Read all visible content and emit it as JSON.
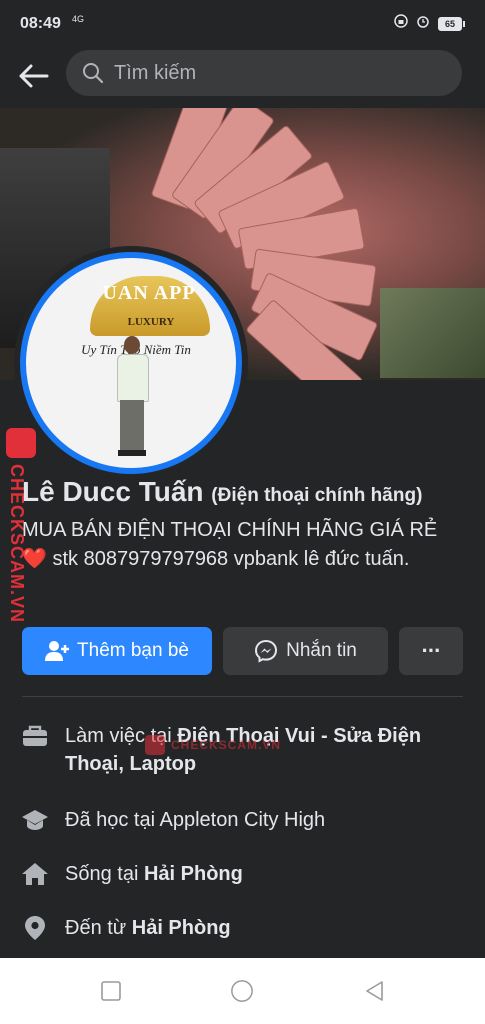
{
  "status_bar": {
    "time": "08:49",
    "network": "4G",
    "battery": "65"
  },
  "search": {
    "placeholder": "Tìm kiếm"
  },
  "avatar": {
    "logo_text": "UAN APP",
    "luxury_text": "LUXURY",
    "slogan": "Uy Tín Tạo Niềm Tin"
  },
  "watermark": {
    "text": "CHECKSCAM.VN"
  },
  "profile": {
    "name": "Lê Ducc Tuấn",
    "name_suffix": "(Điện thoại chính hãng)",
    "bio_part1": "MUA BÁN ĐIỆN THOẠI CHÍNH HÃNG GIÁ RẺ",
    "bio_heart": "❤️",
    "bio_part2": "stk 8087979797968 vpbank lê đức tuấn."
  },
  "actions": {
    "add_friend": "Thêm bạn bè",
    "message": "Nhắn tin",
    "more": "···"
  },
  "info": {
    "work_prefix": "Làm việc tại ",
    "work_place": "Điện Thoại Vui - Sửa Điện Thoại, Laptop",
    "study": "Đã học tại Appleton City High",
    "live_prefix": "Sống tại ",
    "live_place": "Hải Phòng",
    "from_prefix": "Đến từ ",
    "from_place": "Hải Phòng"
  },
  "colors": {
    "background": "#242526",
    "primary_button": "#2d88ff",
    "secondary_button": "#3a3b3c",
    "watermark_red": "#e2303a"
  },
  "icons": [
    "back-arrow-icon",
    "search-icon",
    "add-friend-icon",
    "messenger-icon",
    "more-icon",
    "briefcase-icon",
    "graduation-cap-icon",
    "home-icon",
    "location-pin-icon",
    "square-nav-icon",
    "circle-nav-icon",
    "triangle-nav-icon"
  ]
}
